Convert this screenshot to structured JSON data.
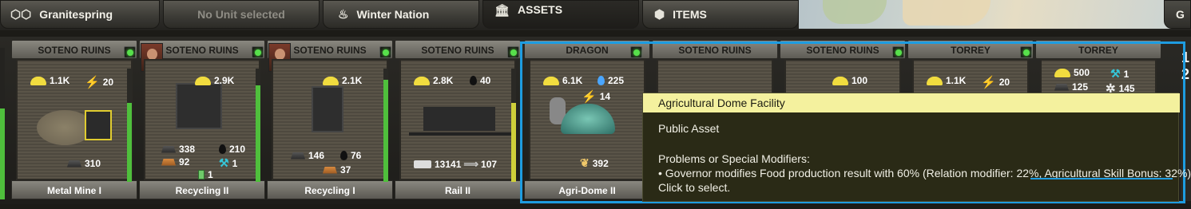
{
  "tabs": [
    {
      "label": "Granitespring",
      "icon": "hexagons-icon"
    },
    {
      "label": "No Unit selected",
      "icon": ""
    },
    {
      "label": "Winter Nation",
      "icon": "flame-icon"
    },
    {
      "label": "ASSETS",
      "icon": "bank-icon"
    },
    {
      "label": "ITEMS",
      "icon": "cube-icon"
    }
  ],
  "tab_right": "G",
  "cards": [
    {
      "title": "SOTENO RUINS",
      "name": "Metal Mine I",
      "helmet": "1.1K",
      "energy": "20",
      "ingot": "310"
    },
    {
      "title": "SOTENO RUINS",
      "name": "Recycling II",
      "helmet": "2.9K",
      "ingot": "338",
      "oil": "210",
      "copper": "92",
      "tool": "1",
      "bottle": "1"
    },
    {
      "title": "SOTENO RUINS",
      "name": "Recycling I",
      "helmet": "2.1K",
      "ingot": "146",
      "oil": "76",
      "copper": "37"
    },
    {
      "title": "SOTENO RUINS",
      "name": "Rail II",
      "helmet": "2.8K",
      "oil": "40",
      "train": "13141",
      "arrow": "107"
    },
    {
      "title": "DRAGON",
      "name": "Agri-Dome II",
      "helmet": "6.1K",
      "water": "225",
      "energy": "14",
      "wheat": "392"
    },
    {
      "title": "SOTENO RUINS",
      "name": ""
    },
    {
      "title": "SOTENO RUINS",
      "name": "",
      "helmet": "100"
    },
    {
      "title": "TORREY",
      "name": "",
      "helmet": "1.1K",
      "energy": "20"
    },
    {
      "title": "TORREY",
      "name": "",
      "helmet": "500",
      "tool": "1",
      "ingot": "125",
      "gear": "145"
    }
  ],
  "right_edge": [
    "1",
    "2"
  ],
  "tooltip": {
    "title": "Agricultural Dome Facility",
    "line1": "Public Asset",
    "line2": "Problems or Special Modifiers:",
    "line3": "• Governor modifies Food production result with 60% (Relation modifier: 22%, Agricultural Skill Bonus: 32%)",
    "line4": "Click to select."
  },
  "colors": {
    "selection": "#1e9ce0",
    "tooltip_header": "#f4f19e",
    "tooltip_bg": "#2a2a16",
    "status_green": "#57e04b"
  }
}
